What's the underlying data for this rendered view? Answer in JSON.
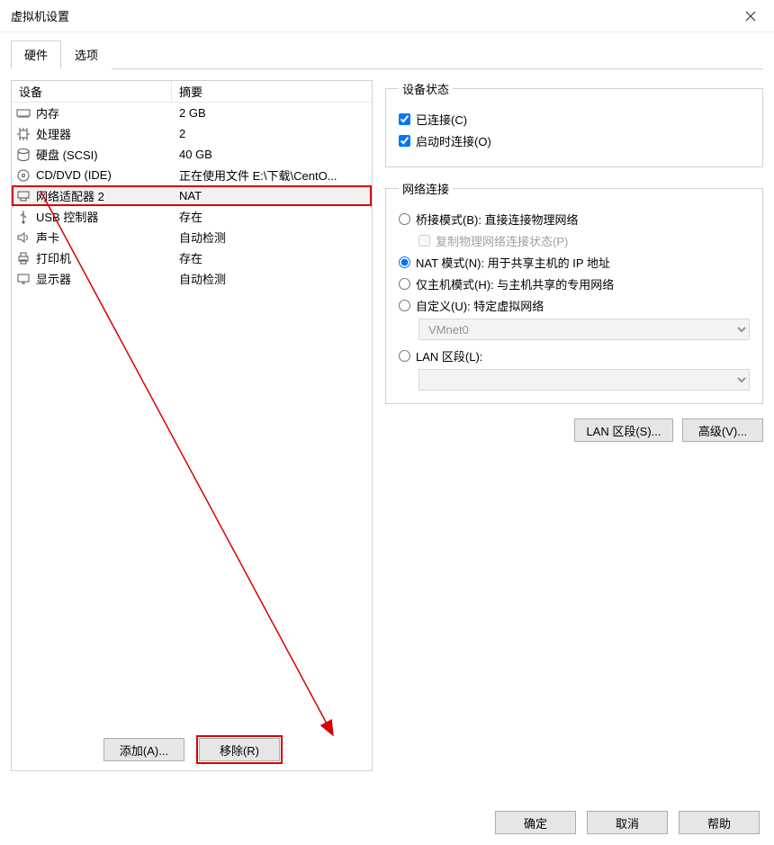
{
  "window": {
    "title": "虚拟机设置"
  },
  "tabs": {
    "hardware": "硬件",
    "options": "选项"
  },
  "list": {
    "header_device": "设备",
    "header_summary": "摘要",
    "rows": [
      {
        "icon": "memory",
        "name": "内存",
        "summary": "2 GB"
      },
      {
        "icon": "cpu",
        "name": "处理器",
        "summary": "2"
      },
      {
        "icon": "disk",
        "name": "硬盘 (SCSI)",
        "summary": "40 GB"
      },
      {
        "icon": "cd",
        "name": "CD/DVD (IDE)",
        "summary": "正在使用文件 E:\\下载\\CentO..."
      },
      {
        "icon": "net",
        "name": "网络适配器 2",
        "summary": "NAT"
      },
      {
        "icon": "usb",
        "name": "USB 控制器",
        "summary": "存在"
      },
      {
        "icon": "sound",
        "name": "声卡",
        "summary": "自动检测"
      },
      {
        "icon": "printer",
        "name": "打印机",
        "summary": "存在"
      },
      {
        "icon": "display",
        "name": "显示器",
        "summary": "自动检测"
      }
    ],
    "selected_index": 4,
    "add_button": "添加(A)...",
    "remove_button": "移除(R)"
  },
  "device_status": {
    "legend": "设备状态",
    "connected": "已连接(C)",
    "connect_at_power_on": "启动时连接(O)"
  },
  "network": {
    "legend": "网络连接",
    "bridged": "桥接模式(B): 直接连接物理网络",
    "replicate": "复制物理网络连接状态(P)",
    "nat": "NAT 模式(N): 用于共享主机的 IP 地址",
    "hostonly": "仅主机模式(H): 与主机共享的专用网络",
    "custom": "自定义(U): 特定虚拟网络",
    "custom_value": "VMnet0",
    "lan_segment": "LAN 区段(L):",
    "lan_segment_value": "",
    "lan_segments_button": "LAN 区段(S)...",
    "advanced_button": "高级(V)..."
  },
  "dialog": {
    "ok": "确定",
    "cancel": "取消",
    "help": "帮助"
  }
}
